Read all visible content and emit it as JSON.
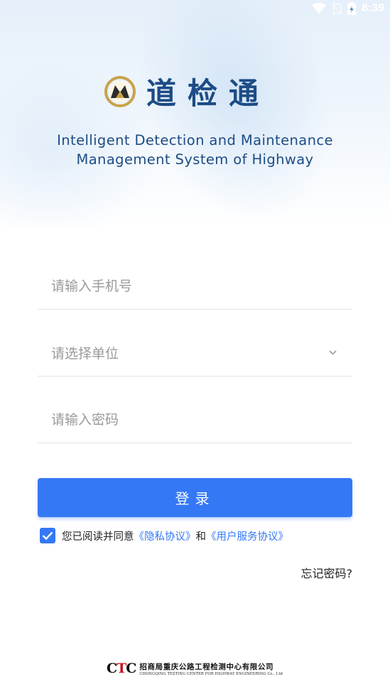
{
  "status_bar": {
    "time": "8:39"
  },
  "header": {
    "app_title": "道检通",
    "subtitle_line1": "Intelligent Detection and Maintenance",
    "subtitle_line2": "Management System of Highway"
  },
  "form": {
    "phone_placeholder": "请输入手机号",
    "unit_placeholder": "请选择单位",
    "password_placeholder": "请输入密码",
    "login_label": "登录",
    "agreement": {
      "checked": true,
      "prefix": "您已阅读并同意",
      "privacy_link": "《隐私协议》",
      "and": "和",
      "service_link": "《用户服务协议》"
    },
    "forgot_label": "忘记密码?"
  },
  "footer": {
    "logo_mark": "CTC",
    "company_cn": "招商局重庆公路工程检测中心有限公司",
    "company_en": "CHONGQING TESTING CENTER FOR HIGHWAY ENGINEERING Co., Ltd"
  },
  "colors": {
    "accent": "#3478f6",
    "title": "#1d4c86",
    "brand_gold": "#c9a24a"
  }
}
